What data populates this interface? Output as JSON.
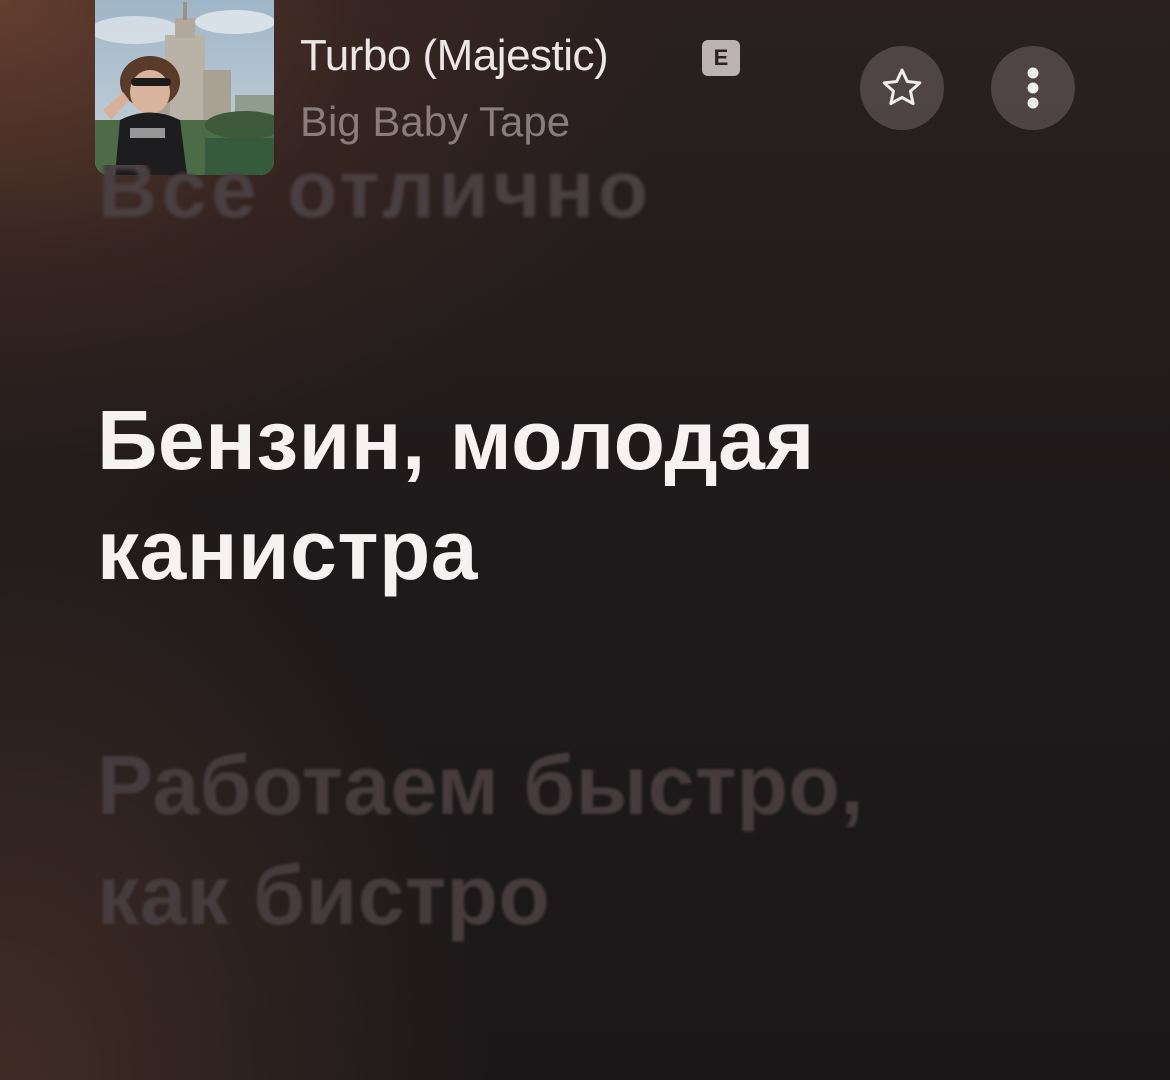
{
  "track": {
    "title": "Turbo (Majestic)",
    "explicit_label": "E",
    "artist": "Big Baby Tape"
  },
  "actions": {
    "favorite_icon": "star-outline-icon",
    "more_icon": "vertical-ellipsis-icon"
  },
  "lyrics": {
    "previous_line": "Все отлично",
    "current_line": "Бензин, молодая\nканистра",
    "next_line": "Работаем быстро,\nкак бистро"
  },
  "colors": {
    "current_lyric": "#f6f2f2",
    "inactive_lyric": "#463c3e",
    "artist_text": "#8a7c7c",
    "button_bg": "#5c5254"
  }
}
